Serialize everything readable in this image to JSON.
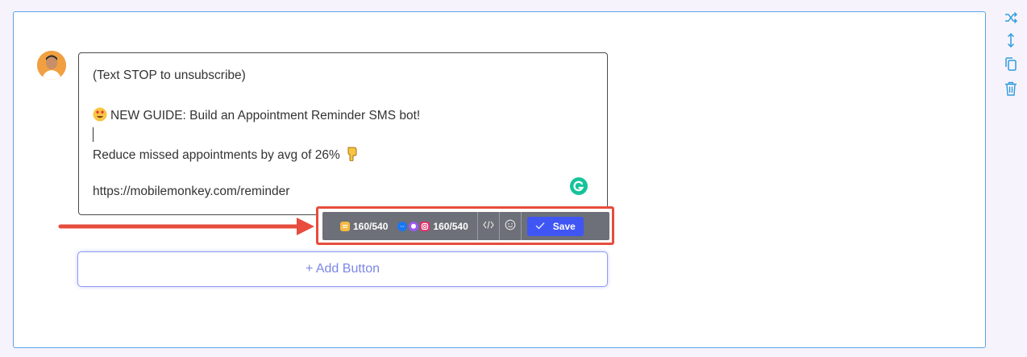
{
  "message": {
    "lines": [
      "(Text STOP to unsubscribe)",
      "NEW GUIDE: Build an Appointment Reminder SMS bot!",
      "Reduce missed appointments by avg of 26%",
      "https://mobilemonkey.com/reminder"
    ],
    "emojis": [
      "heart-eyes-emoji",
      "pointing-down-emoji"
    ]
  },
  "toolbar": {
    "sms_count": "160/540",
    "social_count": "160/540",
    "save_label": "Save"
  },
  "add_button": {
    "label": "+ Add Button"
  },
  "colors": {
    "card_border": "#5aa6e6",
    "highlight": "#e74c3c",
    "toolbar_bg": "#6d7078",
    "save_bg": "#3f56f4",
    "add_button_text": "#7b87e6",
    "side_icons": "#2d9cdb"
  },
  "icons": [
    "shuffle-icon",
    "resize-vertical-icon",
    "copy-icon",
    "trash-icon",
    "grammarly-icon",
    "code-icon",
    "emoji-icon",
    "check-icon"
  ]
}
